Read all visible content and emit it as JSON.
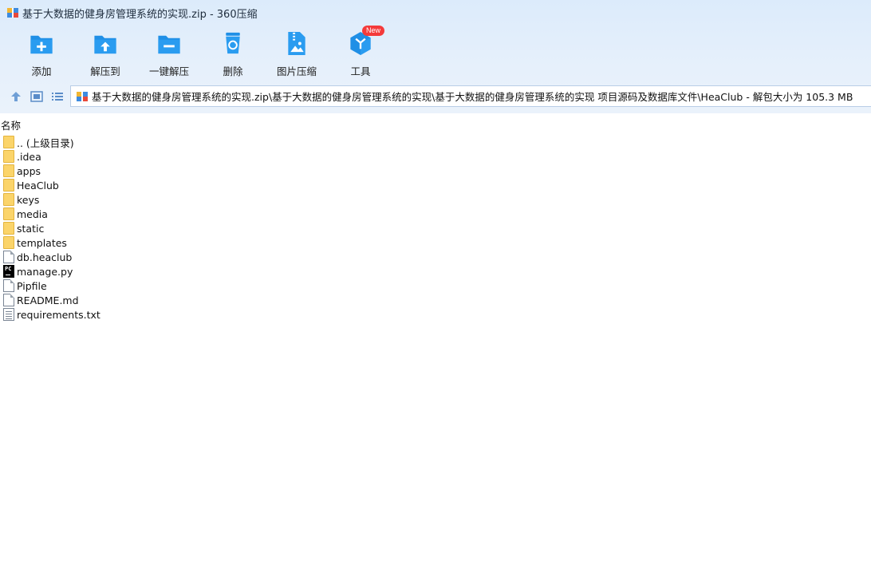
{
  "window": {
    "title": "基于大数据的健身房管理系统的实现.zip - 360压缩"
  },
  "toolbar": {
    "items": [
      {
        "label": "添加",
        "icon": "add-folder-icon"
      },
      {
        "label": "解压到",
        "icon": "extract-to-icon"
      },
      {
        "label": "一键解压",
        "icon": "one-click-extract-icon"
      },
      {
        "label": "删除",
        "icon": "recycle-bin-icon"
      },
      {
        "label": "图片压缩",
        "icon": "image-compress-icon"
      },
      {
        "label": "工具",
        "icon": "tools-cube-icon",
        "badge": "New"
      }
    ]
  },
  "nav": {
    "up_icon": "arrow-up-icon",
    "view_icon": "thumbnail-view-icon",
    "list_icon": "list-view-icon",
    "address": "基于大数据的健身房管理系统的实现.zip\\基于大数据的健身房管理系统的实现\\基于大数据的健身房管理系统的实现  项目源码及数据库文件\\HeaClub - 解包大小为 105.3 MB"
  },
  "columns": {
    "name": "名称"
  },
  "files": [
    {
      "name": ".. (上级目录)",
      "kind": "folder"
    },
    {
      "name": ".idea",
      "kind": "folder"
    },
    {
      "name": "apps",
      "kind": "folder"
    },
    {
      "name": "HeaClub",
      "kind": "folder"
    },
    {
      "name": "keys",
      "kind": "folder"
    },
    {
      "name": "media",
      "kind": "folder"
    },
    {
      "name": "static",
      "kind": "folder"
    },
    {
      "name": "templates",
      "kind": "folder"
    },
    {
      "name": "db.heaclub",
      "kind": "file"
    },
    {
      "name": "manage.py",
      "kind": "pycharm"
    },
    {
      "name": "Pipfile",
      "kind": "file"
    },
    {
      "name": "README.md",
      "kind": "file"
    },
    {
      "name": "requirements.txt",
      "kind": "text"
    }
  ],
  "colors": {
    "accent": "#1f8fe6",
    "folder": "#fbd46a",
    "badge": "#f43a3a"
  }
}
